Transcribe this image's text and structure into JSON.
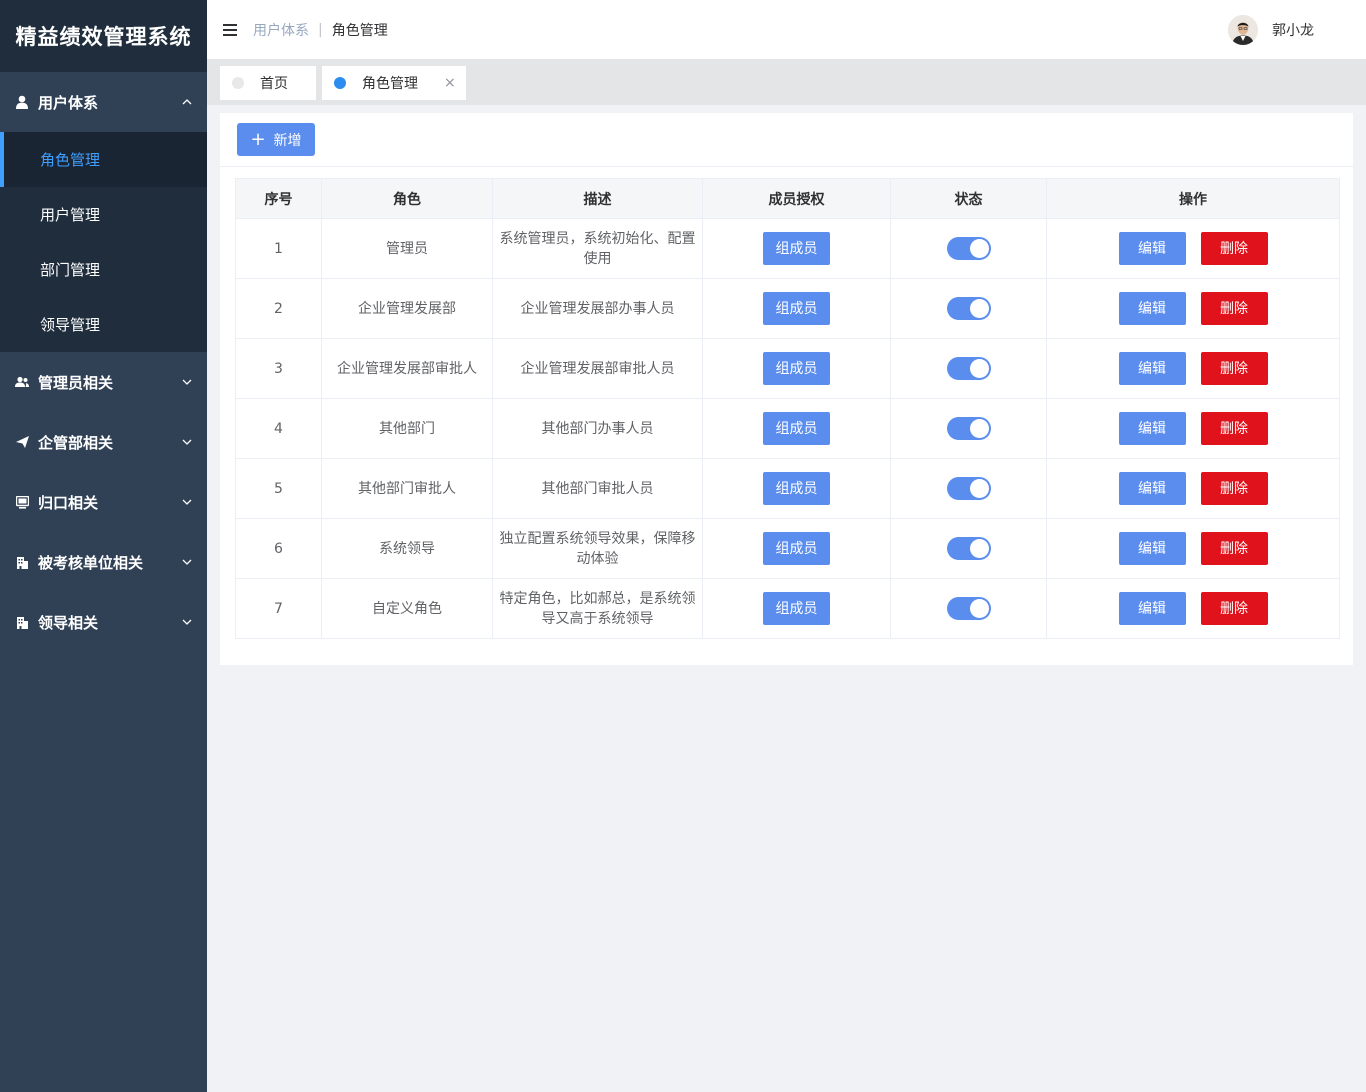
{
  "app": {
    "title": "精益绩效管理系统"
  },
  "sidebar": {
    "groups": [
      {
        "label": "用户体系",
        "icon": "user-icon",
        "expanded": true,
        "items": [
          {
            "label": "角色管理",
            "active": true
          },
          {
            "label": "用户管理"
          },
          {
            "label": "部门管理"
          },
          {
            "label": "领导管理"
          }
        ]
      },
      {
        "label": "管理员相关",
        "icon": "users-icon"
      },
      {
        "label": "企管部相关",
        "icon": "paper-plane-icon"
      },
      {
        "label": "归口相关",
        "icon": "monitor-icon"
      },
      {
        "label": "被考核单位相关",
        "icon": "building-icon"
      },
      {
        "label": "领导相关",
        "icon": "building-icon"
      }
    ]
  },
  "header": {
    "breadcrumb": [
      "用户体系",
      "角色管理"
    ],
    "username": "郭小龙"
  },
  "tabs": [
    {
      "label": "首页",
      "active": false
    },
    {
      "label": "角色管理",
      "active": true,
      "closable": true,
      "close_glyph": "×"
    }
  ],
  "toolbar": {
    "add_label": "新增"
  },
  "table": {
    "columns": [
      "序号",
      "角色",
      "描述",
      "成员授权",
      "状态",
      "操作"
    ],
    "rows": [
      {
        "index": "1",
        "role": "管理员",
        "desc": "系统管理员，系统初始化、配置使用",
        "enabled": true
      },
      {
        "index": "2",
        "role": "企业管理发展部",
        "desc": "企业管理发展部办事人员",
        "enabled": true
      },
      {
        "index": "3",
        "role": "企业管理发展部审批人",
        "desc": "企业管理发展部审批人员",
        "enabled": true
      },
      {
        "index": "4",
        "role": "其他部门",
        "desc": "其他部门办事人员",
        "enabled": true
      },
      {
        "index": "5",
        "role": "其他部门审批人",
        "desc": "其他部门审批人员",
        "enabled": true
      },
      {
        "index": "6",
        "role": "系统领导",
        "desc": "独立配置系统领导效果，保障移动体验",
        "enabled": true
      },
      {
        "index": "7",
        "role": "自定义角色",
        "desc": "特定角色，比如郝总，是系统领导又高于系统领导",
        "enabled": true
      }
    ],
    "member_label": "组成员",
    "edit_label": "编辑",
    "delete_label": "删除"
  },
  "colors": {
    "sidebar_bg": "#304156",
    "submenu_bg": "#1f2d3d",
    "accent": "#409eff",
    "primary_button": "#5a8dee",
    "danger_button": "#e0121b"
  }
}
